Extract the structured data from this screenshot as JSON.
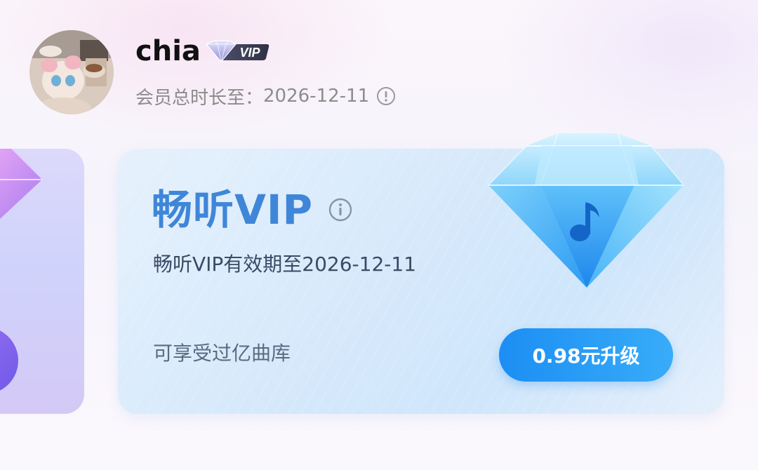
{
  "header": {
    "username": "chia",
    "badge_text": "VIP",
    "member_label": "会员总时长至：",
    "member_date": "2026-12-11"
  },
  "vip_card": {
    "title": "畅听VIP",
    "validity": "畅听VIP有效期至2026-12-11",
    "feature": "可享受过亿曲库",
    "upgrade_label": "0.98元升级"
  },
  "colors": {
    "title_blue": "#3f86d8",
    "button_blue": "#1c8ef4",
    "badge_dark": "#3a3c52",
    "muted_text": "#8c8c8c"
  },
  "icons": {
    "member_info": "info-icon",
    "title_info": "info-icon",
    "diamond": "music-diamond-icon",
    "badge": "vip-diamond-badge-icon"
  }
}
